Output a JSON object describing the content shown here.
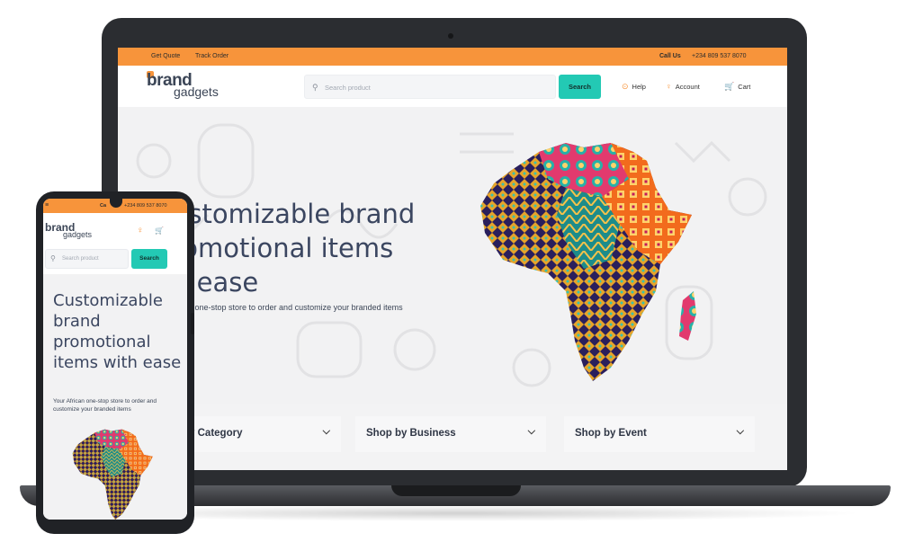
{
  "desktop": {
    "topbar": {
      "get_quote": "Get Quote",
      "track_order": "Track Order",
      "call_label": "Call Us",
      "phone": "+234 809 537 8070"
    },
    "header": {
      "logo_line1": "brand",
      "logo_line2": "gadgets",
      "search_placeholder": "Search product",
      "search_button": "Search",
      "help": "Help",
      "account": "Account",
      "cart": "Cart"
    },
    "hero": {
      "line1": "ustomizable brand",
      "line2": "romotional items",
      "line3": "h ease",
      "subtitle": "n one-stop store to order and customize your branded items"
    },
    "shop": [
      {
        "label": "by Category"
      },
      {
        "label": "Shop by Business"
      },
      {
        "label": "Shop by Event"
      }
    ]
  },
  "mobile": {
    "topbar_call": "Ca",
    "topbar_phone": "+234 809 537 8070",
    "logo_line1": "brand",
    "logo_line2": "gadgets",
    "search_placeholder": "Search product",
    "search_button": "Search",
    "hero_title": "Customizable brand promotional items with ease",
    "hero_subtitle": "Your African one-stop store to order and customize your branded items"
  },
  "colors": {
    "accent_orange": "#f7943b",
    "accent_teal": "#23c9b4",
    "heading": "#3b4660"
  },
  "icons": {
    "search": "search-icon",
    "help": "help-icon",
    "account": "user-icon",
    "cart": "cart-icon",
    "chevron": "chevron-down-icon",
    "menu": "hamburger-icon"
  }
}
